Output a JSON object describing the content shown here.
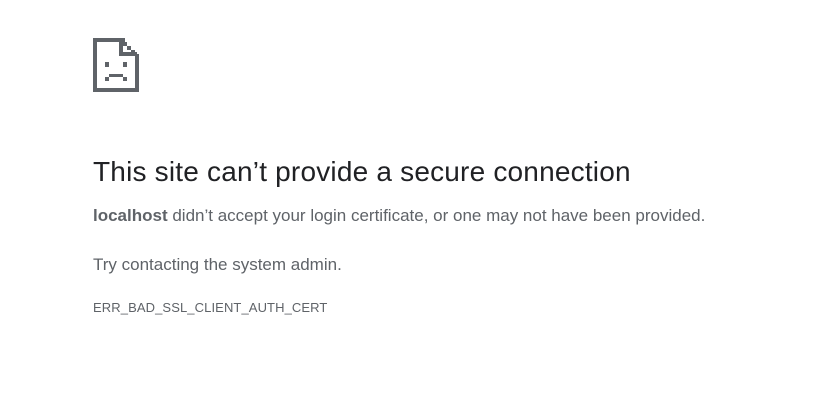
{
  "icon": "sad-page-icon",
  "heading": "This site can’t provide a secure connection",
  "summary": {
    "host": "localhost",
    "text": " didn’t accept your login certificate, or one may not have been provided."
  },
  "suggestion": "Try contacting the system admin.",
  "error_code": "ERR_BAD_SSL_CLIENT_AUTH_CERT",
  "colors": {
    "heading": "#202124",
    "body_text": "#5f6368",
    "icon": "#5f6368"
  }
}
